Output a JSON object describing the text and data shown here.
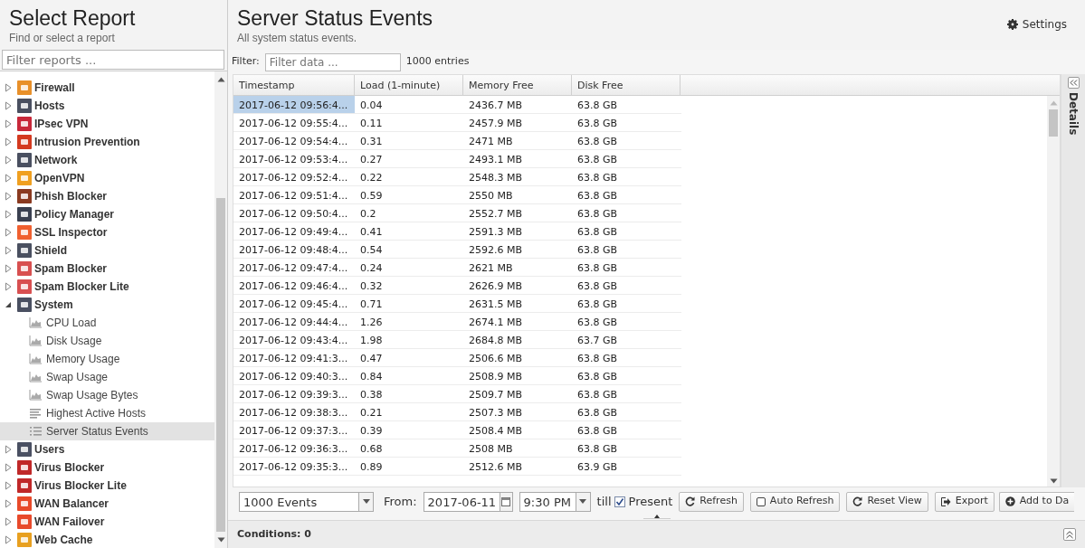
{
  "sidebar": {
    "title": "Select Report",
    "subtitle": "Find or select a report",
    "filter": {
      "placeholder": "Filter reports ..."
    },
    "tree": [
      {
        "label": "Firewall",
        "color": "#e8902a",
        "expanded": false
      },
      {
        "label": "Hosts",
        "color": "#4a5060",
        "expanded": false
      },
      {
        "label": "IPsec VPN",
        "color": "#c8283a",
        "expanded": false
      },
      {
        "label": "Intrusion Prevention",
        "color": "#d43a20",
        "expanded": false
      },
      {
        "label": "Network",
        "color": "#4a5060",
        "expanded": false
      },
      {
        "label": "OpenVPN",
        "color": "#f0a020",
        "expanded": false
      },
      {
        "label": "Phish Blocker",
        "color": "#8a3a20",
        "expanded": false
      },
      {
        "label": "Policy Manager",
        "color": "#3a4050",
        "expanded": false
      },
      {
        "label": "SSL Inspector",
        "color": "#f06030",
        "expanded": false
      },
      {
        "label": "Shield",
        "color": "#4a5060",
        "expanded": false
      },
      {
        "label": "Spam Blocker",
        "color": "#d85050",
        "expanded": false
      },
      {
        "label": "Spam Blocker Lite",
        "color": "#d85051",
        "expanded": false
      },
      {
        "label": "System",
        "color": "#4a5061",
        "expanded": true,
        "children": [
          {
            "label": "CPU Load",
            "kind": "chart",
            "selected": false
          },
          {
            "label": "Disk Usage",
            "kind": "chart",
            "selected": false
          },
          {
            "label": "Memory Usage",
            "kind": "chart",
            "selected": false
          },
          {
            "label": "Swap Usage",
            "kind": "chart",
            "selected": false
          },
          {
            "label": "Swap Usage Bytes",
            "kind": "chart",
            "selected": false
          },
          {
            "label": "Highest Active Hosts",
            "kind": "bars",
            "selected": false
          },
          {
            "label": "Server Status Events",
            "kind": "list",
            "selected": true
          }
        ]
      },
      {
        "label": "Users",
        "color": "#4a5062",
        "expanded": false
      },
      {
        "label": "Virus Blocker",
        "color": "#c02828",
        "expanded": false
      },
      {
        "label": "Virus Blocker Lite",
        "color": "#c02829",
        "expanded": false
      },
      {
        "label": "WAN Balancer",
        "color": "#e84a2a",
        "expanded": false
      },
      {
        "label": "WAN Failover",
        "color": "#e84a2b",
        "expanded": false
      },
      {
        "label": "Web Cache",
        "color": "#e8a020",
        "expanded": false
      }
    ]
  },
  "main": {
    "title": "Server Status Events",
    "subtitle": "All system status events.",
    "settings": "Settings",
    "filter_label": "Filter:",
    "filter": {
      "placeholder": "Filter data ..."
    },
    "count": "1000 entries",
    "table": {
      "columns": [
        "Timestamp",
        "Load (1-minute)",
        "Memory Free",
        "Disk Free"
      ],
      "rows": [
        {
          "cells": [
            "2017-06-12 09:56:4...",
            "0.04",
            "2436.7 MB",
            "63.8 GB"
          ],
          "selected": true
        },
        {
          "cells": [
            "2017-06-12 09:55:4...",
            "0.11",
            "2457.9 MB",
            "63.8 GB"
          ],
          "selected": false
        },
        {
          "cells": [
            "2017-06-12 09:54:4...",
            "0.31",
            "2471 MB",
            "63.8 GB"
          ],
          "selected": false
        },
        {
          "cells": [
            "2017-06-12 09:53:4...",
            "0.27",
            "2493.1 MB",
            "63.8 GB"
          ],
          "selected": false
        },
        {
          "cells": [
            "2017-06-12 09:52:4...",
            "0.22",
            "2548.3 MB",
            "63.8 GB"
          ],
          "selected": false
        },
        {
          "cells": [
            "2017-06-12 09:51:4...",
            "0.59",
            "2550 MB",
            "63.8 GB"
          ],
          "selected": false
        },
        {
          "cells": [
            "2017-06-12 09:50:4...",
            "0.2",
            "2552.7 MB",
            "63.8 GB"
          ],
          "selected": false
        },
        {
          "cells": [
            "2017-06-12 09:49:4...",
            "0.41",
            "2591.3 MB",
            "63.8 GB"
          ],
          "selected": false
        },
        {
          "cells": [
            "2017-06-12 09:48:4...",
            "0.54",
            "2592.6 MB",
            "63.8 GB"
          ],
          "selected": false
        },
        {
          "cells": [
            "2017-06-12 09:47:4...",
            "0.24",
            "2621 MB",
            "63.8 GB"
          ],
          "selected": false
        },
        {
          "cells": [
            "2017-06-12 09:46:4...",
            "0.32",
            "2626.9 MB",
            "63.8 GB"
          ],
          "selected": false
        },
        {
          "cells": [
            "2017-06-12 09:45:4...",
            "0.71",
            "2631.5 MB",
            "63.8 GB"
          ],
          "selected": false
        },
        {
          "cells": [
            "2017-06-12 09:44:4...",
            "1.26",
            "2674.1 MB",
            "63.8 GB"
          ],
          "selected": false
        },
        {
          "cells": [
            "2017-06-12 09:43:4...",
            "1.98",
            "2684.8 MB",
            "63.7 GB"
          ],
          "selected": false
        },
        {
          "cells": [
            "2017-06-12 09:41:3...",
            "0.47",
            "2506.6 MB",
            "63.8 GB"
          ],
          "selected": false
        },
        {
          "cells": [
            "2017-06-12 09:40:3...",
            "0.84",
            "2508.9 MB",
            "63.8 GB"
          ],
          "selected": false
        },
        {
          "cells": [
            "2017-06-12 09:39:3...",
            "0.38",
            "2509.7 MB",
            "63.8 GB"
          ],
          "selected": false
        },
        {
          "cells": [
            "2017-06-12 09:38:3...",
            "0.21",
            "2507.3 MB",
            "63.8 GB"
          ],
          "selected": false
        },
        {
          "cells": [
            "2017-06-12 09:37:3...",
            "0.39",
            "2508.4 MB",
            "63.8 GB"
          ],
          "selected": false
        },
        {
          "cells": [
            "2017-06-12 09:36:3...",
            "0.68",
            "2508 MB",
            "63.8 GB"
          ],
          "selected": false
        },
        {
          "cells": [
            "2017-06-12 09:35:3...",
            "0.89",
            "2512.6 MB",
            "63.9 GB"
          ],
          "selected": false
        }
      ]
    },
    "details": {
      "label": "Details"
    },
    "toolbar": {
      "limit": "1000 Events",
      "from_label": "From:",
      "date": "2017-06-11",
      "time": "9:30 PM",
      "till_label": "till",
      "present": {
        "label": "Present",
        "checked": true
      },
      "buttons": [
        {
          "label": "Refresh",
          "kind": "refresh"
        },
        {
          "label": "Auto Refresh",
          "kind": "toggle",
          "checked": false
        },
        {
          "label": "Reset View",
          "kind": "refresh"
        },
        {
          "label": "Export",
          "kind": "export"
        },
        {
          "label": "Add to Da",
          "kind": "add"
        }
      ]
    },
    "conditions": {
      "label": "Conditions: 0"
    }
  }
}
